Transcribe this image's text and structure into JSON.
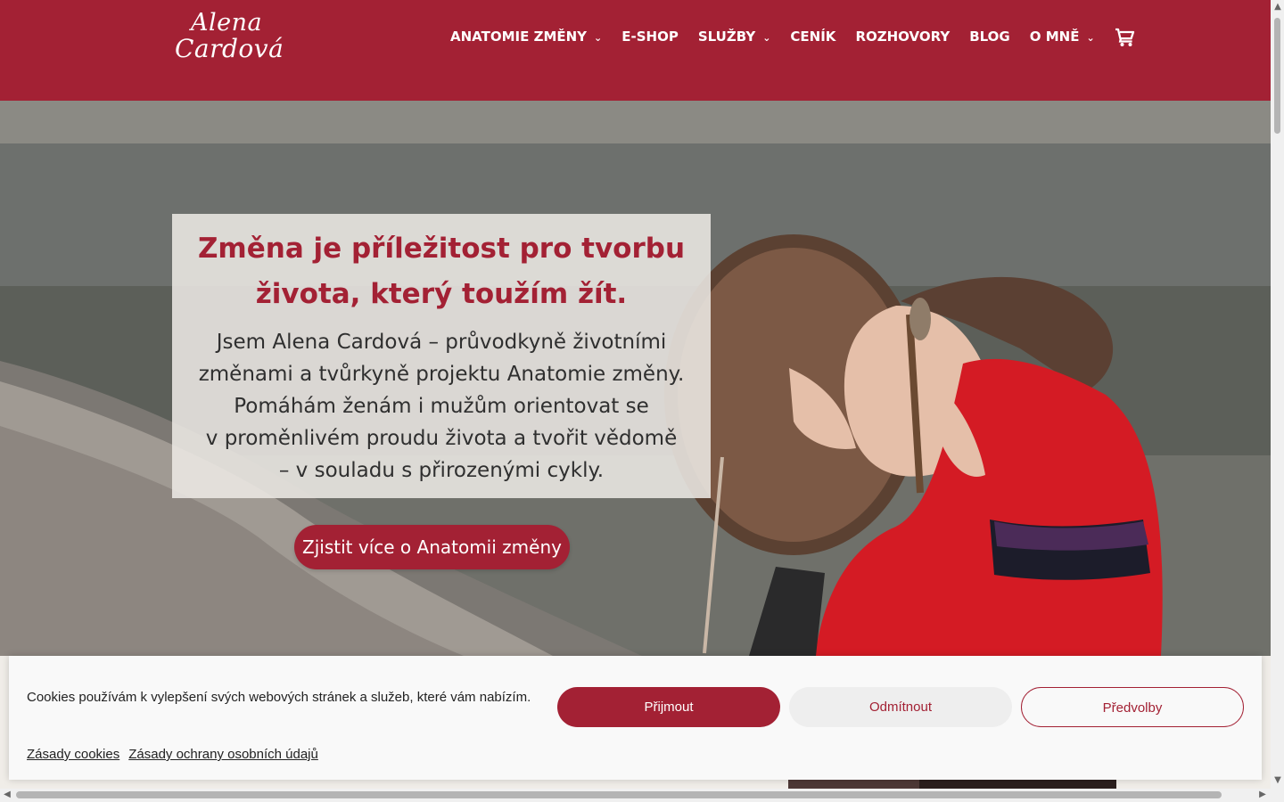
{
  "brand": {
    "line1": "Alena",
    "line2": "Cardová"
  },
  "nav": {
    "items": [
      {
        "label": "ANATOMIE ZMĚNY",
        "dropdown": true
      },
      {
        "label": "E-SHOP",
        "dropdown": false
      },
      {
        "label": "SLUŽBY",
        "dropdown": true
      },
      {
        "label": "CENÍK",
        "dropdown": false
      },
      {
        "label": "ROZHOVORY",
        "dropdown": false
      },
      {
        "label": "BLOG",
        "dropdown": false
      },
      {
        "label": "O MNĚ",
        "dropdown": true
      }
    ],
    "cart_icon": "shopping-cart-icon"
  },
  "hero": {
    "heading_line1": "Změna je příležitost pro tvorbu",
    "heading_line2": "života, který toužím žít.",
    "text_lines": [
      "Jsem Alena Cardová – průvodkyně životními",
      "změnami a tvůrkyně projektu Anatomie změny.",
      "Pomáhám ženám i mužům orientovat se",
      "v proměnlivém proudu života a tvořit vědomě",
      "– v souladu s přirozenými cykly."
    ],
    "cta_label": "Zjistit více o Anatomii změny"
  },
  "cookie": {
    "message": "Cookies používám k vylepšení svých webových stránek a služeb, které vám nabízím.",
    "accept_label": "Přijmout",
    "reject_label": "Odmítnout",
    "prefs_label": "Předvolby",
    "links": [
      "Zásady cookies",
      "Zásady ochrany osobních údajů"
    ]
  },
  "colors": {
    "brand": "#a32134",
    "banner_bg": "#f9f9f9",
    "hero_text": "#2f2f2f"
  }
}
